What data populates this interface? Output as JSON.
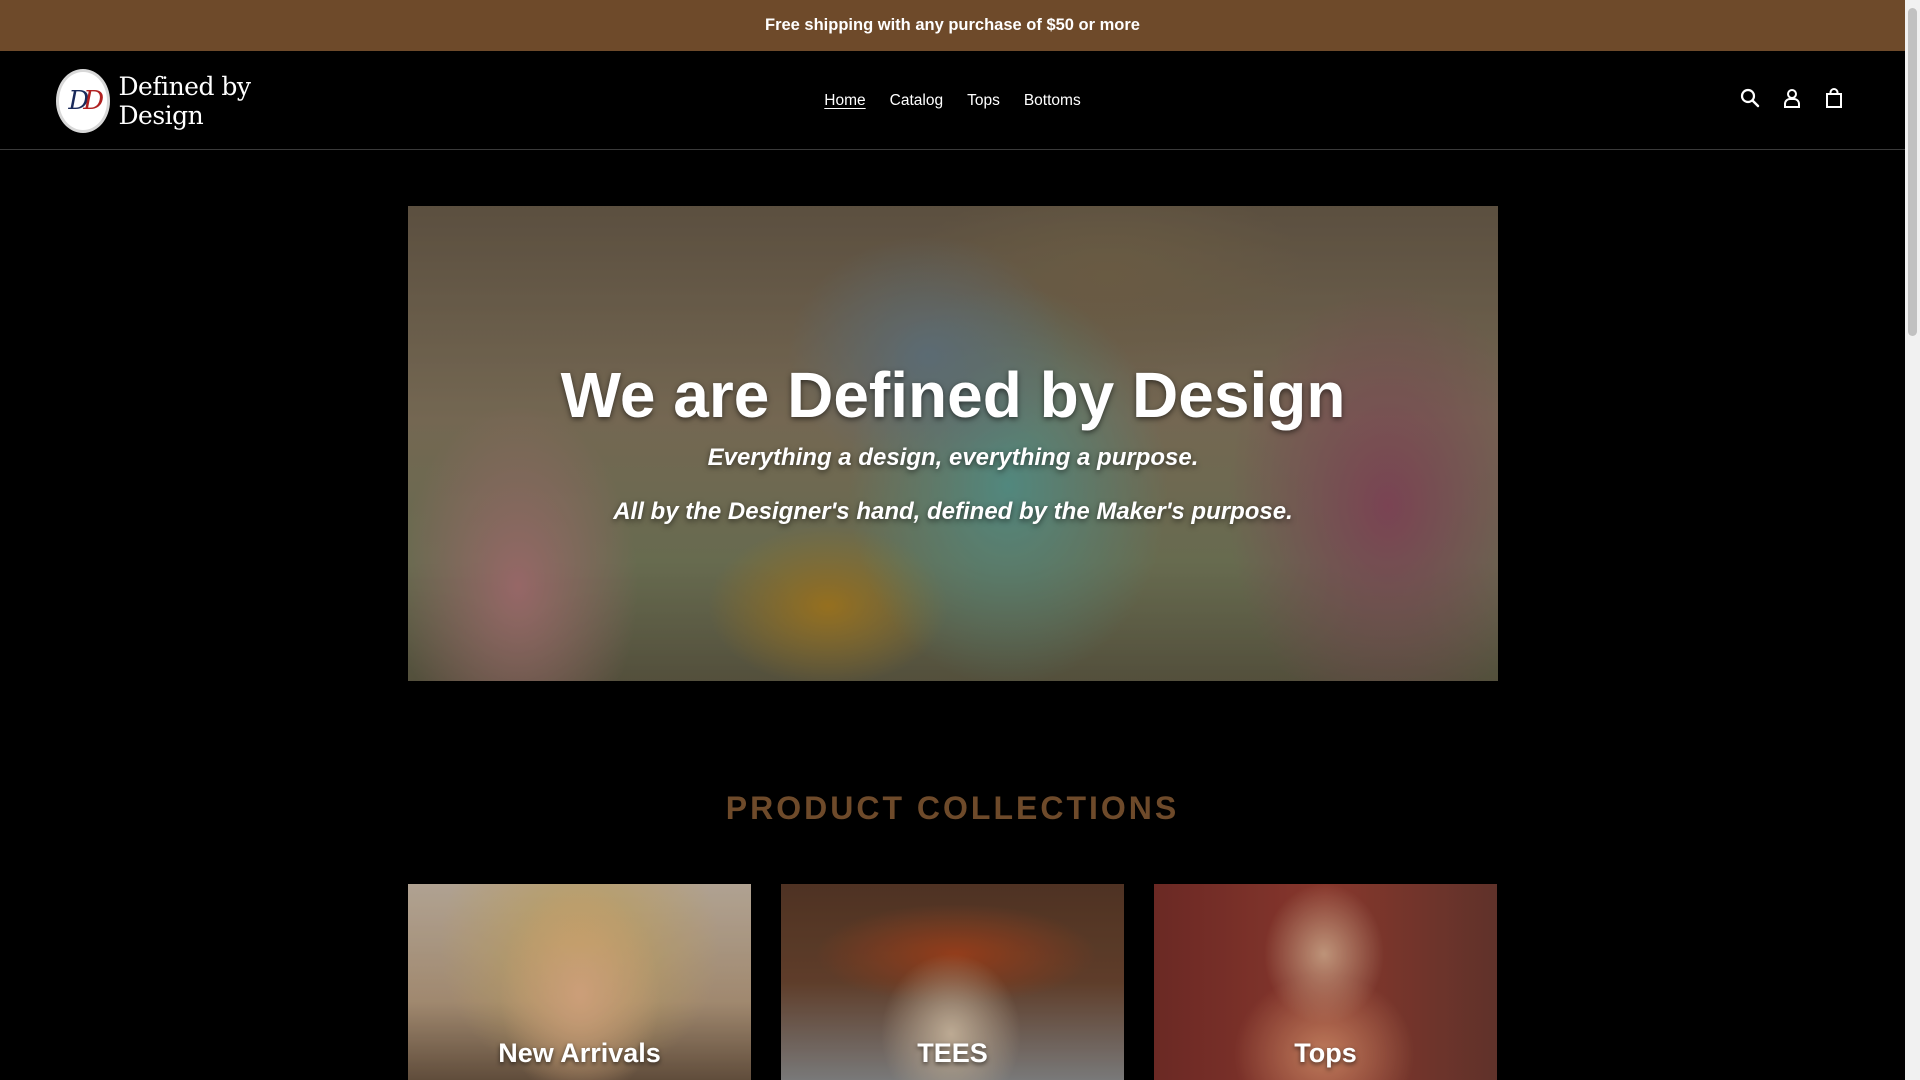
{
  "announcement": {
    "text": "Free shipping with any purchase of $50 or more"
  },
  "header": {
    "logo_text": "Defined by Design",
    "nav": [
      {
        "label": "Home",
        "active": true
      },
      {
        "label": "Catalog",
        "active": false
      },
      {
        "label": "Tops",
        "active": false
      },
      {
        "label": "Bottoms",
        "active": false
      }
    ],
    "icons": [
      "search-icon",
      "account-icon",
      "cart-icon"
    ]
  },
  "hero": {
    "title": "We are Defined by Design",
    "subtitle_1": "Everything a design, everything a purpose.",
    "subtitle_2": "All by the Designer's hand, defined by the Maker's purpose."
  },
  "collections": {
    "title": "PRODUCT COLLECTIONS",
    "items": [
      {
        "label": "New Arrivals"
      },
      {
        "label": "TEES"
      },
      {
        "label": "Tops"
      }
    ]
  },
  "colors": {
    "brand": "#6e4a2a",
    "background": "#000000",
    "text": "#ffffff"
  }
}
